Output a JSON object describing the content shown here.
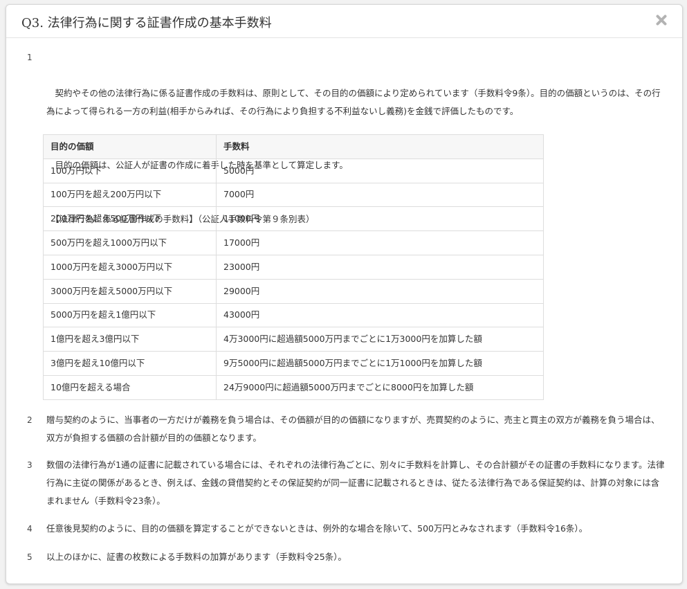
{
  "modal": {
    "title": "Q3. 法律行為に関する証書作成の基本手数料",
    "close_icon": "close-icon"
  },
  "items": [
    {
      "number": "1",
      "paragraphs": [
        "　契約やその他の法律行為に係る証書作成の手数料は、原則として、その目的の価額により定められています（手数料令9条）。目的の価額というのは、その行為によって得られる一方の利益(相手からみれば、その行為により負担する不利益ないし義務)を金銭で評価したものです。",
        "　目的の価額は、公証人が証書の作成に着手した時を基準として算定します。",
        "　【法律行為に係る証書作成の手数料】（公証人手数料令第９条別表）"
      ]
    },
    {
      "number": "2",
      "text": "贈与契約のように、当事者の一方だけが義務を負う場合は、その価額が目的の価額になりますが、売買契約のように、売主と買主の双方が義務を負う場合は、双方が負担する価額の合計額が目的の価額となります。"
    },
    {
      "number": "3",
      "text": "数個の法律行為が1通の証書に記載されている場合には、それぞれの法律行為ごとに、別々に手数料を計算し、その合計額がその証書の手数料になります。法律行為に主従の関係があるとき、例えば、金銭の貸借契約とその保証契約が同一証書に記載されるときは、従たる法律行為である保証契約は、計算の対象には含まれません（手数料令23条）。"
    },
    {
      "number": "4",
      "text": "任意後見契約のように、目的の価額を算定することができないときは、例外的な場合を除いて、500万円とみなされます（手数料令16条）。"
    },
    {
      "number": "5",
      "text": "以上のほかに、証書の枚数による手数料の加算があります（手数料令25条）。"
    }
  ],
  "fee_table": {
    "headers": [
      "目的の価額",
      "手数料"
    ],
    "rows": [
      [
        "100万円以下",
        "5000円"
      ],
      [
        "100万円を超え200万円以下",
        "7000円"
      ],
      [
        "200万円を超え500万円以下",
        "11000円"
      ],
      [
        "500万円を超え1000万円以下",
        "17000円"
      ],
      [
        "1000万円を超え3000万円以下",
        "23000円"
      ],
      [
        "3000万円を超え5000万円以下",
        "29000円"
      ],
      [
        "5000万円を超え1億円以下",
        "43000円"
      ],
      [
        "1億円を超え3億円以下",
        "4万3000円に超過額5000万円までごとに1万3000円を加算した額"
      ],
      [
        "3億円を超え10億円以下",
        "9万5000円に超過額5000万円までごとに1万1000円を加算した額"
      ],
      [
        "10億円を超える場合",
        "24万9000円に超過額5000万円までごとに8000円を加算した額"
      ]
    ]
  }
}
